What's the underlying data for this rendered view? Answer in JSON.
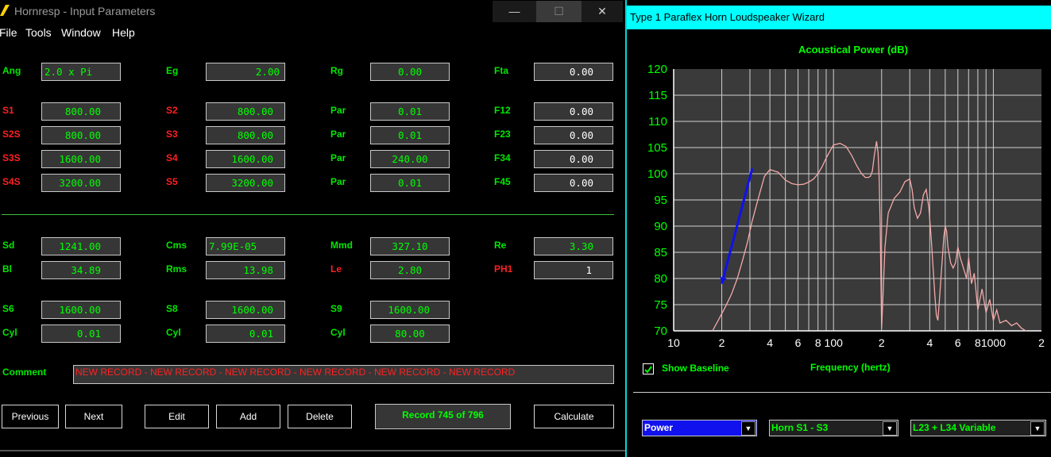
{
  "left_window": {
    "title": "Hornresp - Input Parameters",
    "controls": {
      "minimize": "—",
      "maximize": "☐",
      "close": "✕"
    },
    "menu": [
      "File",
      "Tools",
      "Window",
      "Help"
    ],
    "rows": {
      "ang": {
        "label": "Ang",
        "value": "2.0 x Pi"
      },
      "eg": {
        "label": "Eg",
        "value": "2.00"
      },
      "rg": {
        "label": "Rg",
        "value": "0.00"
      },
      "fta": {
        "label": "Fta",
        "value": "0.00"
      },
      "s1": {
        "label": "S1",
        "value": "800.00"
      },
      "s2": {
        "label": "S2",
        "value": "800.00"
      },
      "par1": {
        "label": "Par",
        "value": "0.01"
      },
      "f12": {
        "label": "F12",
        "value": "0.00"
      },
      "s2s": {
        "label": "S2S",
        "value": "800.00"
      },
      "s3": {
        "label": "S3",
        "value": "800.00"
      },
      "par2": {
        "label": "Par",
        "value": "0.01"
      },
      "f23": {
        "label": "F23",
        "value": "0.00"
      },
      "s3s": {
        "label": "S3S",
        "value": "1600.00"
      },
      "s4": {
        "label": "S4",
        "value": "1600.00"
      },
      "par3": {
        "label": "Par",
        "value": "240.00"
      },
      "f34": {
        "label": "F34",
        "value": "0.00"
      },
      "s4s": {
        "label": "S4S",
        "value": "3200.00"
      },
      "s5": {
        "label": "S5",
        "value": "3200.00"
      },
      "par4": {
        "label": "Par",
        "value": "0.01"
      },
      "f45": {
        "label": "F45",
        "value": "0.00"
      },
      "sd": {
        "label": "Sd",
        "value": "1241.00"
      },
      "cms": {
        "label": "Cms",
        "value": "7.99E-05"
      },
      "mmd": {
        "label": "Mmd",
        "value": "327.10"
      },
      "re": {
        "label": "Re",
        "value": "3.30"
      },
      "bl": {
        "label": "Bl",
        "value": "34.89"
      },
      "rms": {
        "label": "Rms",
        "value": "13.98"
      },
      "le": {
        "label": "Le",
        "value": "2.80"
      },
      "ph1": {
        "label": "PH1",
        "value": "1"
      },
      "s6": {
        "label": "S6",
        "value": "1600.00"
      },
      "s8": {
        "label": "S8",
        "value": "1600.00"
      },
      "s9": {
        "label": "S9",
        "value": "1600.00"
      },
      "cyl1": {
        "label": "Cyl",
        "value": "0.01"
      },
      "cyl2": {
        "label": "Cyl",
        "value": "0.01"
      },
      "cyl3": {
        "label": "Cyl",
        "value": "80.00"
      }
    },
    "comment": {
      "label": "Comment",
      "value": "NEW RECORD - NEW RECORD - NEW RECORD - NEW RECORD - NEW RECORD - NEW RECORD"
    },
    "buttons": {
      "previous": "Previous",
      "next": "Next",
      "edit": "Edit",
      "add": "Add",
      "delete": "Delete",
      "calculate": "Calculate"
    },
    "record": "Record 745 of 796"
  },
  "right_window": {
    "title": "Type 1 Paraflex Horn Loudspeaker Wizard",
    "show_baseline": {
      "label": "Show Baseline",
      "checked": true
    },
    "dropdowns": {
      "mode": "Power",
      "horn": "Horn S1 - S3",
      "segment": "L23 + L34 Variable"
    },
    "colors": {
      "plot_bg": "#3a3a3a",
      "grid": "#d0d0d0",
      "curve": "#f4a9a9",
      "arrow": "#1010ee",
      "label": "#00ff00"
    }
  },
  "chart_data": {
    "type": "line",
    "title": "Acoustical Power (dB)",
    "xlabel": "Frequency (hertz)",
    "ylabel": "",
    "x_scale": "log",
    "xlim": [
      10,
      2000
    ],
    "ylim": [
      70,
      120
    ],
    "x_tick_labels": [
      "10",
      "2",
      "4",
      "6",
      "8",
      "100",
      "2",
      "4",
      "6",
      "8",
      "1000",
      "2"
    ],
    "y_tick_labels": [
      "120",
      "115",
      "110",
      "105",
      "100",
      "95",
      "90",
      "85",
      "80",
      "75",
      "70"
    ],
    "grid": true,
    "series": [
      {
        "x": [
          17.5,
          19,
          21,
          23,
          25,
          27,
          29,
          31,
          34,
          37,
          40,
          45,
          50,
          55,
          60,
          65,
          70,
          75,
          80,
          85,
          90,
          95,
          100,
          110,
          120,
          130,
          140,
          150,
          158,
          165,
          170,
          175,
          180,
          186,
          190,
          193,
          196,
          198,
          200,
          205,
          210,
          220,
          240,
          260,
          280,
          300,
          310,
          320,
          335,
          350,
          365,
          380,
          395,
          410,
          420,
          430,
          440,
          450,
          460,
          470,
          480,
          490,
          500,
          510,
          520,
          540,
          560,
          580,
          600,
          620,
          650,
          680,
          700,
          730,
          760,
          800,
          850,
          900,
          950,
          1000,
          1050,
          1100,
          1200,
          1300,
          1400,
          1500,
          1600
        ],
        "y": [
          70,
          72,
          74.5,
          77,
          80,
          83.5,
          87,
          91,
          95.5,
          99.5,
          100.8,
          100.3,
          98.8,
          98.1,
          97.9,
          98.0,
          98.4,
          99.0,
          100.0,
          101.4,
          103.0,
          104.3,
          105.5,
          105.8,
          105.2,
          103.5,
          101.5,
          100.0,
          99.3,
          99.3,
          99.5,
          100.5,
          103.5,
          106.2,
          104,
          99,
          90,
          80,
          70.5,
          78,
          86,
          92.5,
          95.3,
          96.5,
          98.5,
          99,
          97,
          93.5,
          91.5,
          92.5,
          96,
          97,
          93.5,
          87,
          82,
          77,
          73,
          72,
          76,
          80,
          84,
          88,
          90,
          89,
          86,
          83,
          82,
          83,
          86,
          84,
          82,
          80,
          84,
          79,
          81,
          74,
          78,
          73.5,
          76,
          72,
          74,
          71.5,
          72,
          71,
          71.5,
          70.5,
          70
        ]
      }
    ],
    "annotations": [
      {
        "type": "arrow",
        "from": {
          "x": 31,
          "y": 101
        },
        "to": {
          "x": 20,
          "y": 79
        }
      }
    ]
  }
}
